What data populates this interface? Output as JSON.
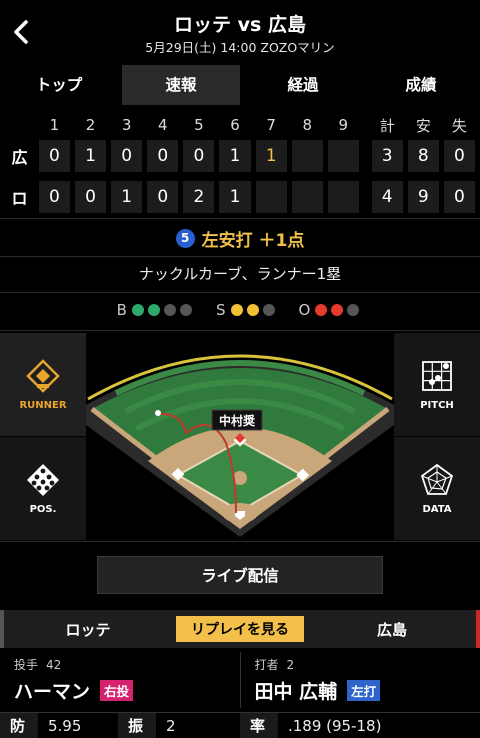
{
  "header": {
    "title": "ロッテ vs 広島",
    "subtitle": "5月29日(土) 14:00 ZOZOマリン"
  },
  "tabs": [
    "トップ",
    "速報",
    "経過",
    "成績"
  ],
  "scoreboard": {
    "innings": [
      "1",
      "2",
      "3",
      "4",
      "5",
      "6",
      "7",
      "8",
      "9"
    ],
    "total_headers": [
      "計",
      "安",
      "失"
    ],
    "teams": [
      {
        "abbr": "広",
        "innings": [
          "0",
          "1",
          "0",
          "0",
          "0",
          "1",
          "1",
          "",
          ""
        ],
        "totals": [
          "3",
          "8",
          "0"
        ]
      },
      {
        "abbr": "ロ",
        "innings": [
          "0",
          "0",
          "1",
          "0",
          "2",
          "1",
          "",
          "",
          ""
        ],
        "totals": [
          "4",
          "9",
          "0"
        ]
      }
    ]
  },
  "play": {
    "order": "5",
    "result": "左安打 ＋1点",
    "pitch_description": "ナックルカーブ、ランナー1塁"
  },
  "count": {
    "balls_label": "B",
    "strikes_label": "S",
    "outs_label": "O",
    "balls": 2,
    "strikes": 2,
    "outs": 2,
    "balls_max": 4,
    "strikes_max": 3,
    "outs_max": 3
  },
  "field": {
    "batter_tag": "中村奨"
  },
  "side_buttons": {
    "runner": "RUNNER",
    "pos": "POS.",
    "pitch": "PITCH",
    "data": "DATA"
  },
  "live_button": "ライブ配信",
  "team_bar": {
    "left": "ロッテ",
    "replay": "リプレイを見る",
    "right": "広島"
  },
  "pitcher": {
    "role": "投手",
    "number": "42",
    "name": "ハーマン",
    "hand": "右投"
  },
  "batter": {
    "role": "打者",
    "number": "2",
    "name": "田中 広輔",
    "hand": "左打"
  },
  "stats": {
    "era_key": "防",
    "era_val": "5.95",
    "k_key": "振",
    "k_val": "2",
    "avg_key": "率",
    "avg_val": ".189 (95-18)"
  },
  "colors": {
    "accent": "#f2c04a",
    "ball": "#2fa86b",
    "strike": "#f2c033",
    "out": "#e53a2e"
  }
}
